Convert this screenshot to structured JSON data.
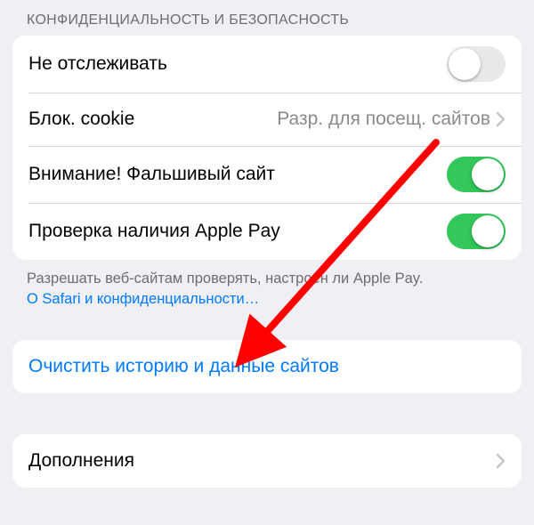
{
  "colors": {
    "accent": "#007aff",
    "toggle_on": "#34c759",
    "annotation_arrow": "#ff0000"
  },
  "section_header": "КОНФИДЕНЦИАЛЬНОСТЬ И БЕЗОПАСНОСТЬ",
  "rows": {
    "do_not_track": {
      "label": "Не отслеживать",
      "on": false
    },
    "block_cookies": {
      "label": "Блок. cookie",
      "value": "Разр. для посещ. сайтов"
    },
    "fraud_warning": {
      "label": "Внимание! Фальшивый сайт",
      "on": true
    },
    "apple_pay_check": {
      "label": "Проверка наличия Apple Pay",
      "on": true
    }
  },
  "footer": {
    "text": "Разрешать веб-сайтам проверять, настроен ли Apple Pay.",
    "link": "О Safari и конфиденциальности…"
  },
  "clear_row": {
    "label": "Очистить историю и данные сайтов"
  },
  "addons_row": {
    "label": "Дополнения"
  }
}
